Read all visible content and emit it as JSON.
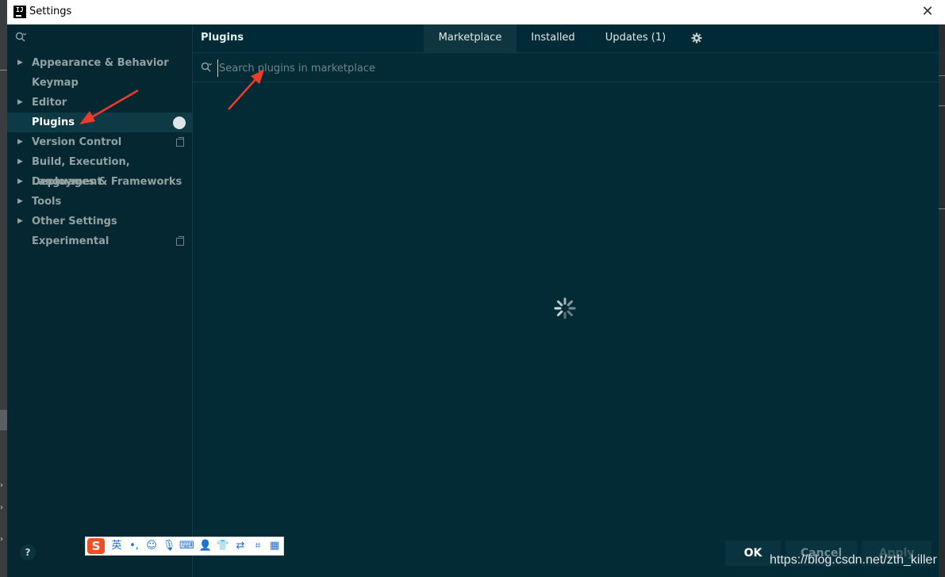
{
  "window": {
    "title": "Settings"
  },
  "sidebar": {
    "items": [
      {
        "label": "Appearance & Behavior",
        "expandable": true
      },
      {
        "label": "Keymap",
        "expandable": false
      },
      {
        "label": "Editor",
        "expandable": true
      },
      {
        "label": "Plugins",
        "expandable": false,
        "selected": true
      },
      {
        "label": "Version Control",
        "expandable": true
      },
      {
        "label": "Build, Execution, Deployment",
        "expandable": true
      },
      {
        "label": "Languages & Frameworks",
        "expandable": true
      },
      {
        "label": "Tools",
        "expandable": true
      },
      {
        "label": "Other Settings",
        "expandable": true
      },
      {
        "label": "Experimental",
        "expandable": false
      }
    ],
    "help_label": "?"
  },
  "main": {
    "title": "Plugins",
    "tabs": [
      "Marketplace",
      "Installed",
      "Updates (1)"
    ],
    "active_tab": "Marketplace",
    "search_placeholder": "Search plugins in marketplace",
    "status": "loading"
  },
  "buttons": {
    "ok": "OK",
    "cancel": "Cancel",
    "apply": "Apply"
  },
  "ime": {
    "logo": "S",
    "lang": "英",
    "punct": "•,"
  },
  "watermark": "https://blog.csdn.net/zth_killer",
  "colors": {
    "bg": "#002b36",
    "sidebar": "#042731",
    "annotation_arrow": "#f03a2a"
  }
}
